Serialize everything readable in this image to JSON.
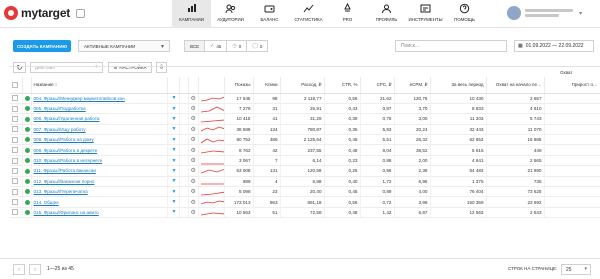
{
  "app": {
    "logo_text": "mytarget"
  },
  "nav": [
    {
      "label": "Кампании",
      "icon": "campaigns-icon"
    },
    {
      "label": "Аудитории",
      "icon": "audiences-icon"
    },
    {
      "label": "Баланс",
      "icon": "balance-icon"
    },
    {
      "label": "Статистика",
      "icon": "statistics-icon"
    },
    {
      "label": "PRO",
      "icon": "pro-icon"
    },
    {
      "label": "Профиль",
      "icon": "profile-icon"
    },
    {
      "label": "Инструменты",
      "icon": "tools-icon"
    },
    {
      "label": "Помощь",
      "icon": "help-icon"
    }
  ],
  "filters": {
    "create_label": "СОЗДАТЬ КАМПАНИЮ",
    "campaign_filter": "АКТИВНЫЕ КАМПАНИИ",
    "status_all": "ВСЕ",
    "status_active_count": "45",
    "status_paused_count": "0",
    "status_deleted_count": "0",
    "search_placeholder": "Поиск...",
    "date_range": "01.09.2022 — 22.09.2022"
  },
  "toolbar": {
    "action_placeholder": "Действия",
    "settings_label": "НАСТРОЙКА"
  },
  "table": {
    "columns": [
      "Название",
      "Показы",
      "Клики",
      "Расход, ₽",
      "CTR, %",
      "CPC, ₽",
      "eCPM, ₽",
      "За весь период",
      "Охват на начало пе…",
      "Прирост о…"
    ],
    "header_extra": "Охват",
    "rows": [
      {
        "name": "004. Фразы//Менеджер маркетплейсов кон",
        "shows": "17 545",
        "clicks": "98",
        "spent": "2 118,77",
        "ctr": "0,56",
        "cpc": "21,62",
        "ecpm": "120,76",
        "period": "10 430",
        "reach_start": "2 657",
        "growth": ""
      },
      {
        "name": "005. Фразы//Подработка",
        "shows": "7 278",
        "clicks": "31",
        "spent": "26,91",
        "ctr": "0,43",
        "cpc": "0,87",
        "ecpm": "3,70",
        "period": "8 833",
        "reach_start": "4 610",
        "growth": ""
      },
      {
        "name": "006. Фразы//Удаленная работа",
        "shows": "10 415",
        "clicks": "41",
        "spent": "31,29",
        "ctr": "0,39",
        "cpc": "0,76",
        "ecpm": "3,00",
        "period": "11 203",
        "reach_start": "5 743",
        "growth": ""
      },
      {
        "name": "007. Фразы//Ищу работу",
        "shows": "38 589",
        "clicks": "134",
        "spent": "780,87",
        "ctr": "0,35",
        "cpc": "5,83",
        "ecpm": "20,24",
        "period": "32 443",
        "reach_start": "11 070",
        "growth": ""
      },
      {
        "name": "008. Фразы//Работа на дому",
        "shows": "80 752",
        "clicks": "386",
        "spent": "2 125,64",
        "ctr": "0,48",
        "cpc": "5,51",
        "ecpm": "26,32",
        "period": "62 653",
        "reach_start": "16 885",
        "growth": ""
      },
      {
        "name": "009. Фразы//Работа в декрете",
        "shows": "8 762",
        "clicks": "42",
        "spent": "237,55",
        "ctr": "0,48",
        "cpc": "8,04",
        "ecpm": "38,52",
        "period": "5 615",
        "reach_start": "449",
        "growth": ""
      },
      {
        "name": "010. Фразы//Работа в интернете",
        "shows": "3 067",
        "clicks": "7",
        "spent": "6,14",
        "ctr": "0,23",
        "cpc": "0,88",
        "ecpm": "2,00",
        "period": "4 641",
        "reach_start": "2 565",
        "growth": ""
      },
      {
        "name": "011. Фразы//Работа вакансии",
        "shows": "53 008",
        "clicks": "131",
        "spent": "120,58",
        "ctr": "0,25",
        "cpc": "0,96",
        "ecpm": "2,38",
        "period": "54 483",
        "reach_start": "21 890",
        "growth": ""
      },
      {
        "name": "012. Фразы//Вакансии порно",
        "shows": "989",
        "clicks": "4",
        "spent": "6,88",
        "ctr": "0,40",
        "cpc": "1,72",
        "ecpm": "6,96",
        "period": "1 375",
        "reach_start": "735",
        "growth": ""
      },
      {
        "name": "013. Фразы//Перепечатка",
        "shows": "5 098",
        "clicks": "23",
        "spent": "20,40",
        "ctr": "0,45",
        "cpc": "0,89",
        "ecpm": "4,00",
        "period": "76 404",
        "reach_start": "73 625",
        "growth": ""
      },
      {
        "name": "014. Общее",
        "shows": "173 013",
        "clicks": "963",
        "spent": "691,18",
        "ctr": "0,56",
        "cpc": "0,72",
        "ecpm": "3,99",
        "period": "150 359",
        "reach_start": "23 692",
        "growth": ""
      },
      {
        "name": "015. Фразы//Фриланс на авито",
        "shows": "10 563",
        "clicks": "51",
        "spent": "72,58",
        "ctr": "0,48",
        "cpc": "1,42",
        "ecpm": "6,87",
        "period": "12 563",
        "reach_start": "2 543",
        "growth": ""
      }
    ]
  },
  "footer": {
    "page_info": "1—25 из 45",
    "per_page_label": "СТРОК НА СТРАНИЦЕ:",
    "per_page_value": "25"
  },
  "colors": {
    "accent": "#1a9ae8",
    "active": "#35a853",
    "brand": "#e53935"
  }
}
